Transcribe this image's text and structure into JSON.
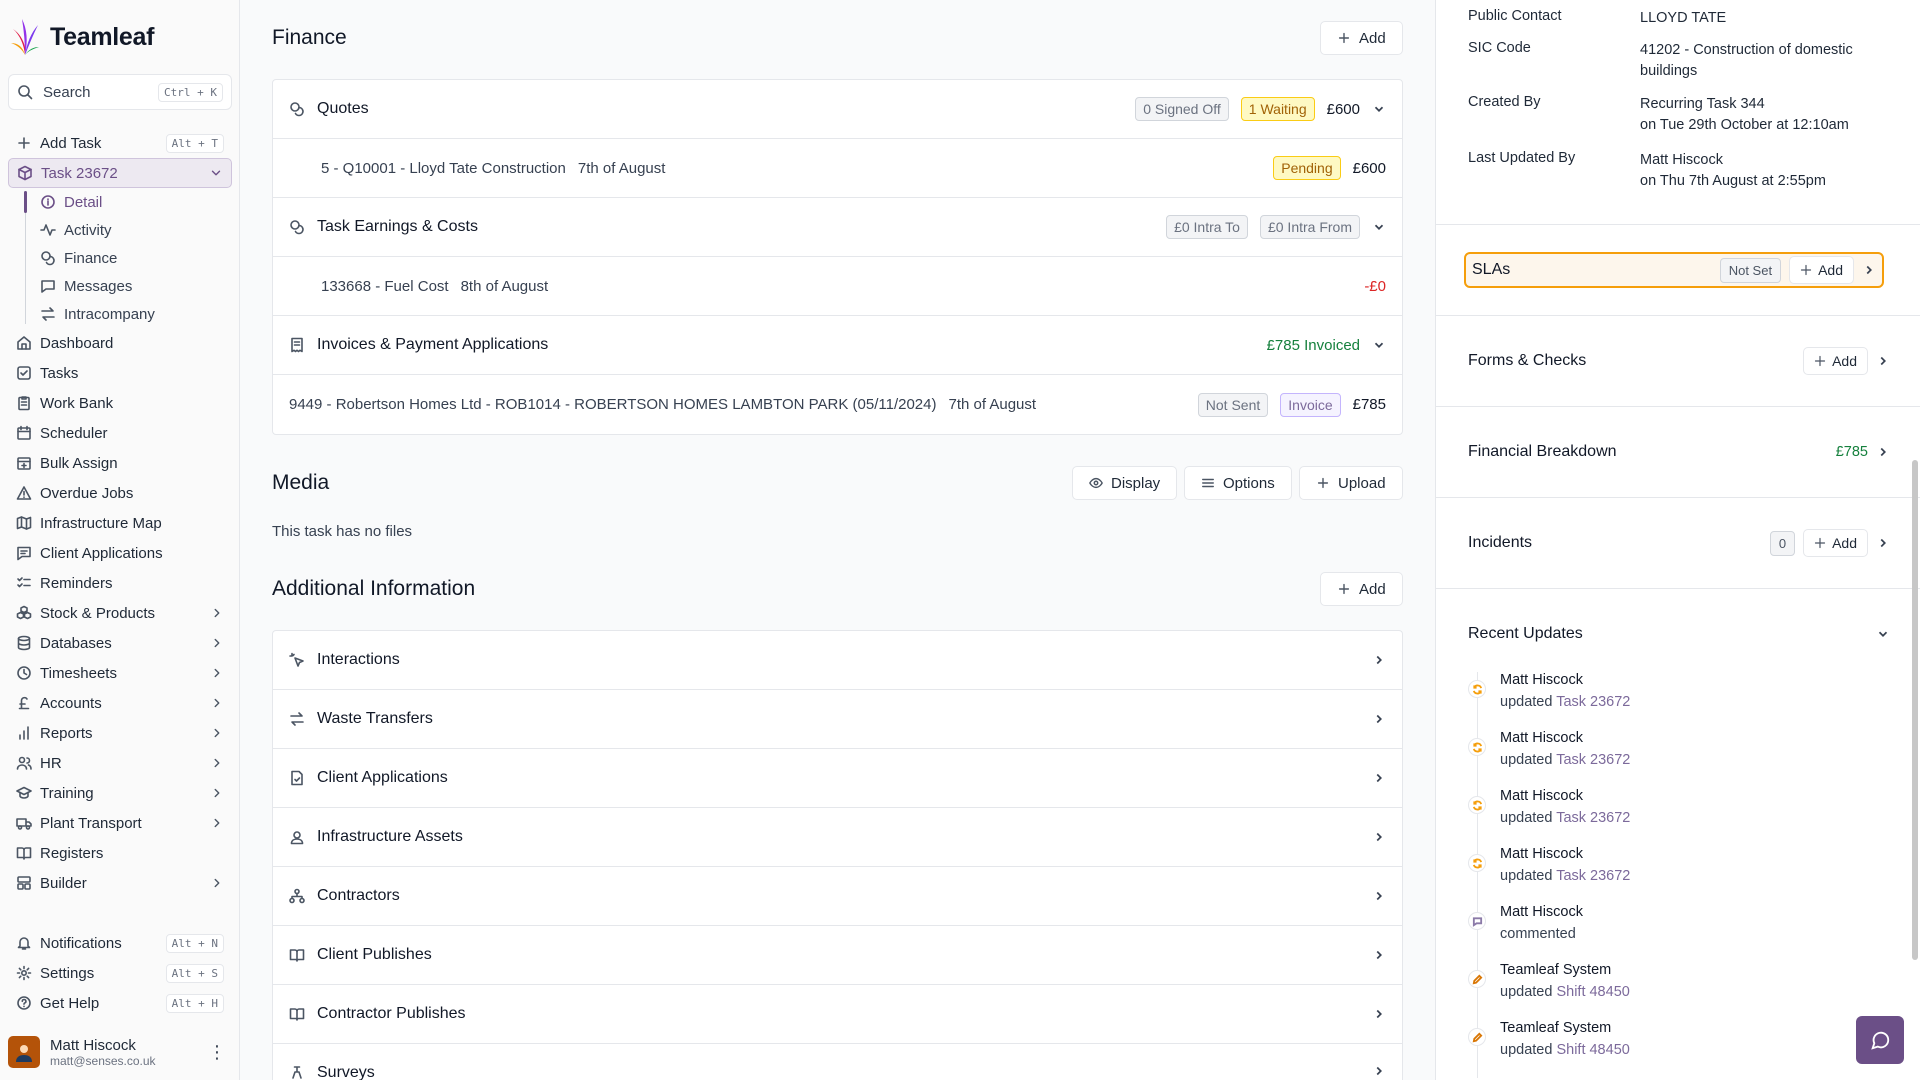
{
  "app": {
    "name": "Teamleaf"
  },
  "search": {
    "label": "Search",
    "shortcut": "Ctrl + K"
  },
  "sidebar": {
    "add_task": {
      "label": "Add Task",
      "shortcut": "Alt + T"
    },
    "task": {
      "label": "Task 23672"
    },
    "task_sub": [
      {
        "label": "Detail"
      },
      {
        "label": "Activity"
      },
      {
        "label": "Finance"
      },
      {
        "label": "Messages"
      },
      {
        "label": "Intracompany"
      }
    ],
    "items": [
      {
        "label": "Dashboard"
      },
      {
        "label": "Tasks"
      },
      {
        "label": "Work Bank"
      },
      {
        "label": "Scheduler"
      },
      {
        "label": "Bulk Assign"
      },
      {
        "label": "Overdue Jobs"
      },
      {
        "label": "Infrastructure Map"
      },
      {
        "label": "Client Applications"
      },
      {
        "label": "Reminders"
      },
      {
        "label": "Stock & Products"
      },
      {
        "label": "Databases"
      },
      {
        "label": "Timesheets"
      },
      {
        "label": "Accounts"
      },
      {
        "label": "Reports"
      },
      {
        "label": "HR"
      },
      {
        "label": "Training"
      },
      {
        "label": "Plant Transport"
      },
      {
        "label": "Registers"
      },
      {
        "label": "Builder"
      }
    ],
    "bottom": [
      {
        "label": "Notifications",
        "shortcut": "Alt + N"
      },
      {
        "label": "Settings",
        "shortcut": "Alt + S"
      },
      {
        "label": "Get Help",
        "shortcut": "Alt + H"
      }
    ],
    "user": {
      "name": "Matt Hiscock",
      "email": "matt@senses.co.uk"
    }
  },
  "finance": {
    "title": "Finance",
    "add_label": "Add",
    "quotes": {
      "title": "Quotes",
      "signed_off": "0 Signed Off",
      "waiting": "1 Waiting",
      "total": "£600"
    },
    "quote_row": {
      "ref": "5 - Q10001 - Lloyd Tate Construction",
      "date": "7th of August",
      "status": "Pending",
      "amount": "£600"
    },
    "earnings": {
      "title": "Task Earnings & Costs",
      "intra_to": "£0 Intra To",
      "intra_from": "£0 Intra From"
    },
    "earning_row": {
      "ref": "133668 - Fuel Cost",
      "date": "8th of August",
      "amount": "-£0"
    },
    "invoices": {
      "title": "Invoices & Payment Applications",
      "invoiced": "£785 Invoiced"
    },
    "invoice_row": {
      "ref": "9449 - Robertson Homes Ltd - ROB1014 - ROBERTSON HOMES LAMBTON PARK (05/11/2024)",
      "date": "7th of August",
      "status": "Not Sent",
      "type": "Invoice",
      "amount": "£785"
    }
  },
  "media": {
    "title": "Media",
    "display_label": "Display",
    "options_label": "Options",
    "upload_label": "Upload",
    "empty": "This task has no files"
  },
  "additional": {
    "title": "Additional Information",
    "add_label": "Add",
    "rows": [
      {
        "label": "Interactions"
      },
      {
        "label": "Waste Transfers"
      },
      {
        "label": "Client Applications"
      },
      {
        "label": "Infrastructure Assets"
      },
      {
        "label": "Contractors"
      },
      {
        "label": "Client Publishes"
      },
      {
        "label": "Contractor Publishes"
      },
      {
        "label": "Surveys"
      }
    ]
  },
  "details": {
    "public_contact": {
      "key": "Public Contact",
      "value": "LLOYD TATE"
    },
    "sic_code": {
      "key": "SIC Code",
      "value": "41202 - Construction of domestic buildings"
    },
    "created_by": {
      "key": "Created By",
      "value1": "Recurring Task 344",
      "value2": "on Tue 29th October at 12:10am"
    },
    "last_updated_by": {
      "key": "Last Updated By",
      "value1": "Matt Hiscock",
      "value2": "on Thu 7th August at 2:55pm"
    }
  },
  "panels": {
    "slas": {
      "title": "SLAs",
      "status": "Not Set",
      "add_label": "Add"
    },
    "forms": {
      "title": "Forms & Checks",
      "add_label": "Add"
    },
    "financial": {
      "title": "Financial Breakdown",
      "amount": "£785"
    },
    "incidents": {
      "title": "Incidents",
      "count": "0",
      "add_label": "Add"
    },
    "recent": {
      "title": "Recent Updates"
    }
  },
  "updates": [
    {
      "name": "Matt Hiscock",
      "action": "updated",
      "link": "Task 23672",
      "kind": "refresh"
    },
    {
      "name": "Matt Hiscock",
      "action": "updated",
      "link": "Task 23672",
      "kind": "refresh"
    },
    {
      "name": "Matt Hiscock",
      "action": "updated",
      "link": "Task 23672",
      "kind": "refresh"
    },
    {
      "name": "Matt Hiscock",
      "action": "updated",
      "link": "Task 23672",
      "kind": "refresh"
    },
    {
      "name": "Matt Hiscock",
      "action": "commented",
      "link": "",
      "kind": "comment"
    },
    {
      "name": "Teamleaf System",
      "action": "updated",
      "link": "Shift 48450",
      "kind": "edit"
    },
    {
      "name": "Teamleaf System",
      "action": "updated",
      "link": "Shift 48450",
      "kind": "edit"
    }
  ],
  "colors": {
    "accent": "#6b4f87",
    "highlight": "#f59e0b",
    "success": "#15803d",
    "danger": "#dc2626"
  }
}
